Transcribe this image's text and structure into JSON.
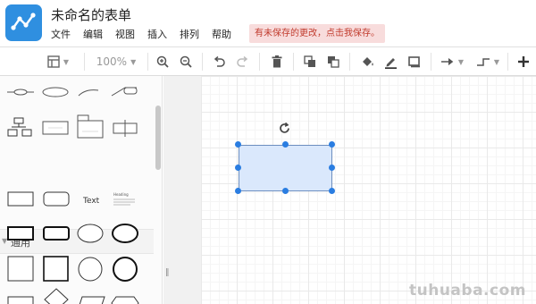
{
  "app": {
    "title": "未命名的表单",
    "menus": [
      "文件",
      "编辑",
      "视图",
      "插入",
      "排列",
      "帮助"
    ],
    "unsaved_notice": "有未保存的更改，点击我保存。"
  },
  "toolbar": {
    "zoom": "100%",
    "accent_color": "#2f8fe0"
  },
  "sidebar": {
    "section_general": "通用",
    "shape_text": "Text",
    "shape_heading": "Heading"
  },
  "watermark": "tuhuaba.com"
}
